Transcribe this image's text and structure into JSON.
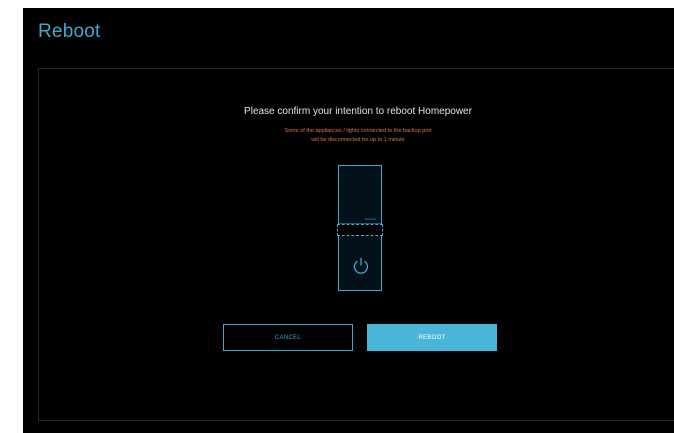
{
  "page": {
    "title": "Reboot"
  },
  "dialog": {
    "confirm_text": "Please confirm your intention to reboot Homepower",
    "warning_line1": "Some of the appliances / lights connected to the backup port",
    "warning_line2": "will be disconnected for up to 1 minute",
    "device_label": "Gridset",
    "cancel_label": "CANCEL",
    "reboot_label": "REBOOT"
  },
  "colors": {
    "accent": "#3fa9d2",
    "primary_button": "#49b5d8",
    "warning": "#e0743a",
    "background": "#000000"
  },
  "icons": {
    "power": "power-icon"
  }
}
